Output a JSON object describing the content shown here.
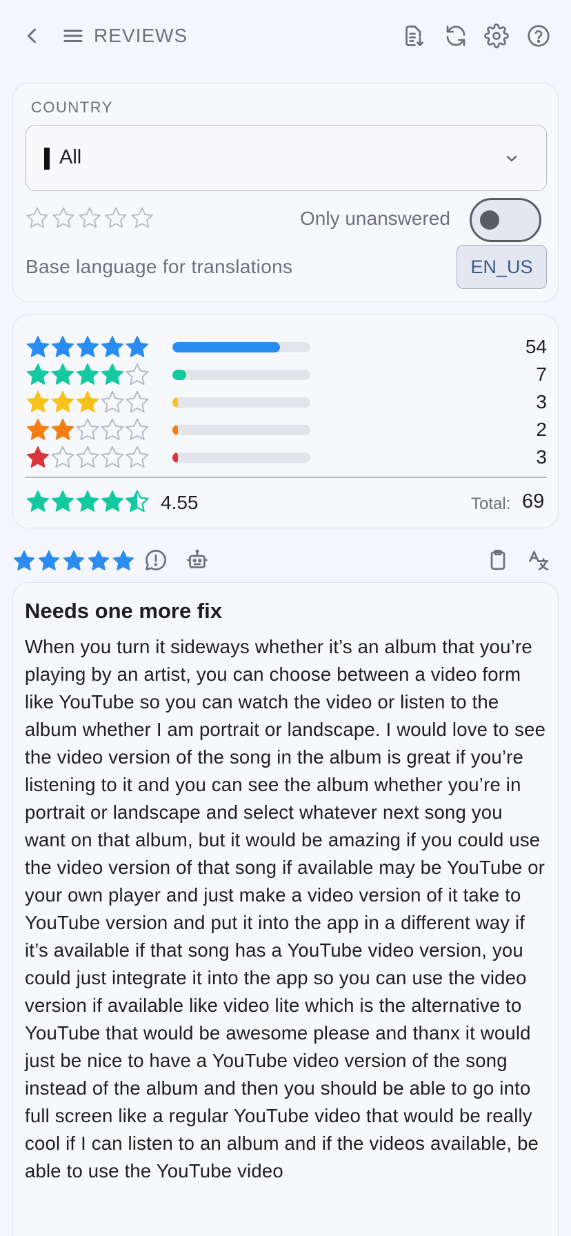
{
  "header": {
    "title": "REVIEWS"
  },
  "filters": {
    "country_label": "COUNTRY",
    "country_value": "All",
    "rating_filter_selected": 0,
    "only_unanswered_label": "Only unanswered",
    "only_unanswered_on": false,
    "base_language_label": "Base language for translations",
    "base_language_value": "EN_US"
  },
  "summary": {
    "rows": [
      {
        "stars": 5,
        "count": "54",
        "fill_fraction": 0.78,
        "color": "#2a8cf0"
      },
      {
        "stars": 4,
        "count": "7",
        "fill_fraction": 0.1,
        "color": "#12c9a0"
      },
      {
        "stars": 3,
        "count": "3",
        "fill_fraction": 0.04,
        "color": "#f8c21a"
      },
      {
        "stars": 2,
        "count": "2",
        "fill_fraction": 0.03,
        "color": "#f47e12"
      },
      {
        "stars": 1,
        "count": "3",
        "fill_fraction": 0.04,
        "color": "#d8343a"
      }
    ],
    "average": "4.55",
    "average_color": "#12c9a0",
    "total_label": "Total:",
    "total_value": "69"
  },
  "review": {
    "rating": 5,
    "star_color": "#2a8cf0",
    "title": "Needs one more fix",
    "body": "When you turn it sideways whether it’s an album that you’re playing by an artist, you can choose between a video form like YouTube so you can watch the video or listen to the album whether I am portrait or landscape. I would love to see the video version of the song in the album is great if you’re listening to it and you can see the album whether you’re in portrait or landscape and select whatever next song you want on that album, but it would be amazing if you could use the video version of that song if available may be YouTube or your own player and just make a video version of it take to YouTube version and put it into the app in a different way if it’s available if that song has a YouTube video version, you could just integrate it into the app so you can use the video version if available like video lite which is the alternative to YouTube that would be awesome please and thanx it would just be nice to have a YouTube video version of the song instead of the album and then you should be able to go into full screen like a regular YouTube video that would be really cool if I can listen to an album and if the videos available, be able to use the YouTube video"
  },
  "icons": {
    "back": "back-arrow-icon",
    "menu": "menu-icon",
    "export": "export-document-icon",
    "refresh": "refresh-icon",
    "settings": "settings-gear-icon",
    "help": "help-icon",
    "report": "report-icon",
    "bot": "bot-icon",
    "clipboard": "clipboard-icon",
    "translate": "translate-icon"
  }
}
